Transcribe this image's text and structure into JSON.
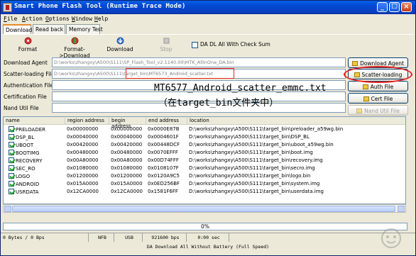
{
  "window": {
    "title": "Smart Phone Flash Tool (Runtime Trace Mode)",
    "controls": {
      "minimize": "_",
      "maximize": "□",
      "close": "×"
    }
  },
  "menu": [
    "File",
    "Action",
    "Options",
    "Window",
    "Help"
  ],
  "tabs": [
    "Download",
    "Read back",
    "Memory Test"
  ],
  "toolbar": {
    "format": "Format",
    "format_download": "Format->Download",
    "download": "Download",
    "stop": "Stop",
    "da_dl_all_check": "DA DL All With Check Sum"
  },
  "fields": {
    "download_agent_label": "Download Agent",
    "download_agent_value": "D:\\works\\zhangxy\\A500\\S111\\SP_Flash_Tool_v2.1140.00\\MTK_AllInOne_DA.bin",
    "scatter_label": "Scatter-loading File",
    "scatter_value_prefix": "D:\\works\\zhangxy\\A500\\S111\\",
    "scatter_value_highlight": "target_bin\\MT6573_Android_scatter.txt",
    "auth_label": "Authentication File",
    "cert_label": "Certification File",
    "nand_label": "Nand Util File"
  },
  "side_buttons": {
    "download_agent": "Download Agent",
    "scatter_loading": "Scatter-loading",
    "auth_file": "Auth File",
    "cert_file": "Cert File",
    "nand_util_file": "Nand Util File"
  },
  "annotation": {
    "line1": "MT6577_Android_scatter_emmc.txt",
    "line2": "（在target_bin文件夹中）"
  },
  "table": {
    "columns": [
      "name",
      "region address",
      "begin address",
      "end address",
      "location"
    ],
    "rows": [
      {
        "name": "PRELOADER",
        "region": "0x00000000",
        "begin": "0x00000000",
        "end": "0x0000E87B",
        "location": "D:\\works\\zhangxy\\A500\\S111\\target_bin\\preloader_a59wg.bin"
      },
      {
        "name": "DSP_BL",
        "region": "0x00040000",
        "begin": "0x00040000",
        "end": "0x0004601F",
        "location": "D:\\works\\zhangxy\\A500\\S111\\target_bin\\DSP_BL"
      },
      {
        "name": "UBOOT",
        "region": "0x00420000",
        "begin": "0x00420000",
        "end": "0x00448DCF",
        "location": "D:\\works\\zhangxy\\A500\\S111\\target_bin\\uboot_a59wg.bin"
      },
      {
        "name": "BOOTIMG",
        "region": "0x00480000",
        "begin": "0x00480000",
        "end": "0x0070EFFF",
        "location": "D:\\works\\zhangxy\\A500\\S111\\target_bin\\boot.img"
      },
      {
        "name": "RECOVERY",
        "region": "0x00A80000",
        "begin": "0x00A80000",
        "end": "0x00D74FFF",
        "location": "D:\\works\\zhangxy\\A500\\S111\\target_bin\\recovery.img"
      },
      {
        "name": "SEC_RO",
        "region": "0x01080000",
        "begin": "0x01080000",
        "end": "0x0108107F",
        "location": "D:\\works\\zhangxy\\A500\\S111\\target_bin\\secro.img"
      },
      {
        "name": "LOGO",
        "region": "0x01200000",
        "begin": "0x01200000",
        "end": "0x0120A9C5",
        "location": "D:\\works\\zhangxy\\A500\\S111\\target_bin\\logo.bin"
      },
      {
        "name": "ANDROID",
        "region": "0x015A0000",
        "begin": "0x015A0000",
        "end": "0x0ED256BF",
        "location": "D:\\works\\zhangxy\\A500\\S111\\target_bin\\system.img"
      },
      {
        "name": "USRDATA",
        "region": "0x12CA0000",
        "begin": "0x12CA0000",
        "end": "0x1581F6FF",
        "location": "D:\\works\\zhangxy\\A500\\S111\\target_bin\\userdata.img"
      }
    ]
  },
  "progress": {
    "text": "0%"
  },
  "status": {
    "bytes": "0 Bytes / 0 Bps",
    "nfb": "NFB",
    "usb": "USB",
    "baud": "921600 bps",
    "time": "0:00 sec",
    "note": "DA Download All Without Battery (Full Speed)"
  },
  "colors": {
    "title_bar": "#0a5fe8",
    "annotation_red": "#e8201a",
    "checkbox_green": "#21a121"
  }
}
